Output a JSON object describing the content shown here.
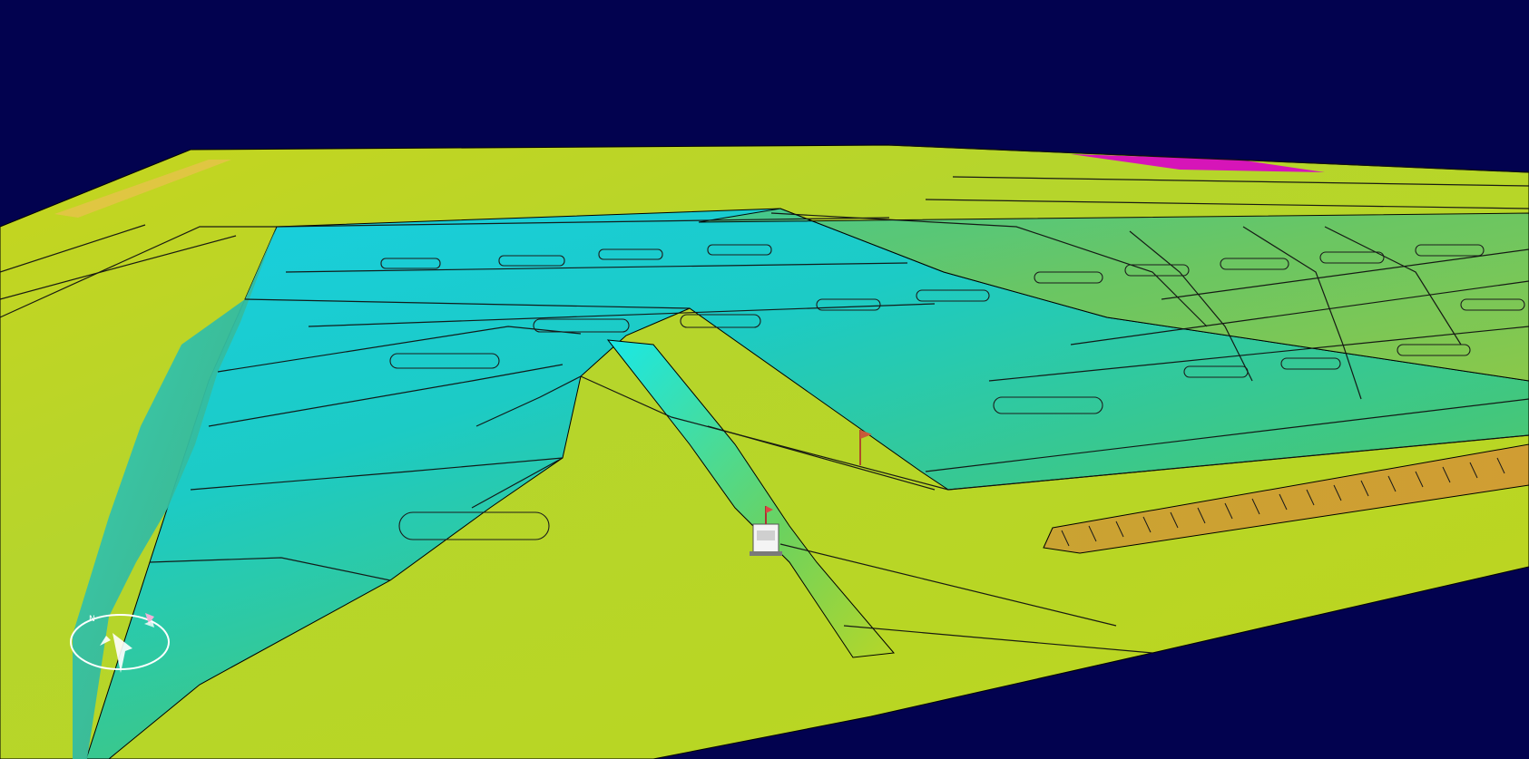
{
  "viewport": {
    "background_color": "#02024f",
    "terrain_colors": {
      "yellow": "#c8d41c",
      "light_yellow_green": "#b5d92b",
      "green": "#6fcf4d",
      "teal": "#2fcfa7",
      "cyan": "#12d7e8",
      "orange_trench": "#cda12f",
      "magenta": "#d900c8",
      "lines": "#111111"
    }
  },
  "compass": {
    "north_label": "N",
    "icon": "compass-icon"
  },
  "markers": {
    "vehicle_icon": "vehicle-icon",
    "flag_icon": "flag-icon"
  }
}
